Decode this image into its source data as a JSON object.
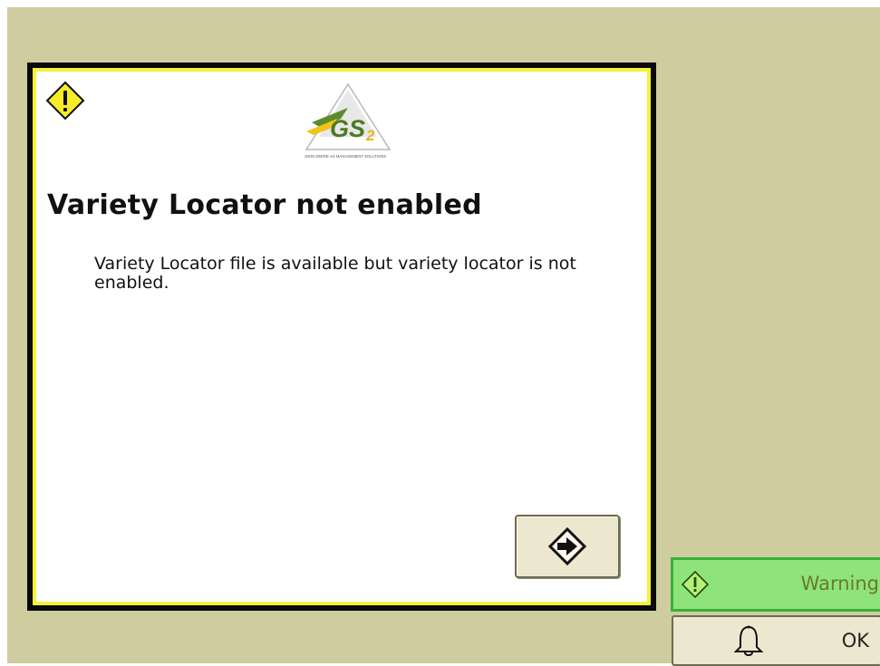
{
  "dialog": {
    "title": "Variety Locator not enabled",
    "message": "Variety Locator file is available but variety locator is not enabled.",
    "logo_text": "GS",
    "logo_subscript": "2",
    "logo_caption": "JOHN DEERE AG MANAGEMENT SOLUTIONS",
    "next_button_icon": "arrow-right-diamond-icon"
  },
  "status": {
    "warning_label": "Warning",
    "warning_icon": "warning-diamond-icon",
    "ok_label": "OK",
    "ok_icon": "bell-icon"
  },
  "colors": {
    "background": "#cfcc9f",
    "dialog_border": "#0a0a0a",
    "dialog_inner_border": "#f6f23a",
    "warning_fill": "#8ee37a",
    "warning_border": "#39b234",
    "button_fill": "#ece7cf"
  }
}
